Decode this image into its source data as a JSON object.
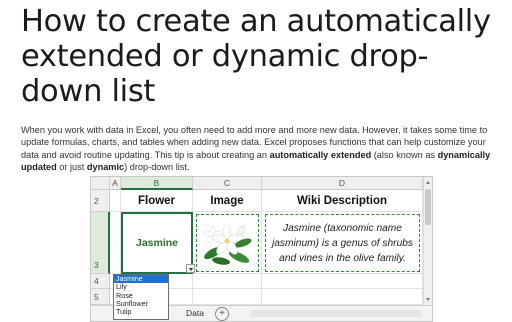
{
  "article": {
    "title": "How to create an automatically extended or dynamic drop-down list",
    "intro": [
      {
        "t": "When you work with data in Excel, you often need to add more and more new data. However, it takes some time to update formulas, charts, and tables when adding new data. Excel proposes functions that can help customize your data and avoid routine updating. This tip is about creating an ",
        "b": false
      },
      {
        "t": "automatically extended",
        "b": true
      },
      {
        "t": " (also known as ",
        "b": false
      },
      {
        "t": "dynamically updated",
        "b": true
      },
      {
        "t": " or just ",
        "b": false
      },
      {
        "t": "dynamic",
        "b": true
      },
      {
        "t": ") drop-down list.",
        "b": false
      }
    ]
  },
  "sheet": {
    "columns": [
      "A",
      "B",
      "C",
      "D"
    ],
    "rows": [
      "2",
      "3",
      "4",
      "5"
    ],
    "headers": {
      "flower": "Flower",
      "image": "Image",
      "wiki": "Wiki Description"
    },
    "selected_value": "Jasmine",
    "wiki_text": "Jasmine (taxonomic name jasminum) is a genus of shrubs and vines in the olive family.",
    "dropdown_options": [
      "Jasmine",
      "Lily",
      "Rose",
      "Sunflower",
      "Tulip"
    ],
    "highlighted_option": "Jasmine",
    "sheet_tab": "Data",
    "add_tab": "+"
  },
  "colors": {
    "excel_green": "#217346",
    "dashed_border": "#2e8b3e",
    "dropdown_highlight": "#1d6fd6"
  }
}
